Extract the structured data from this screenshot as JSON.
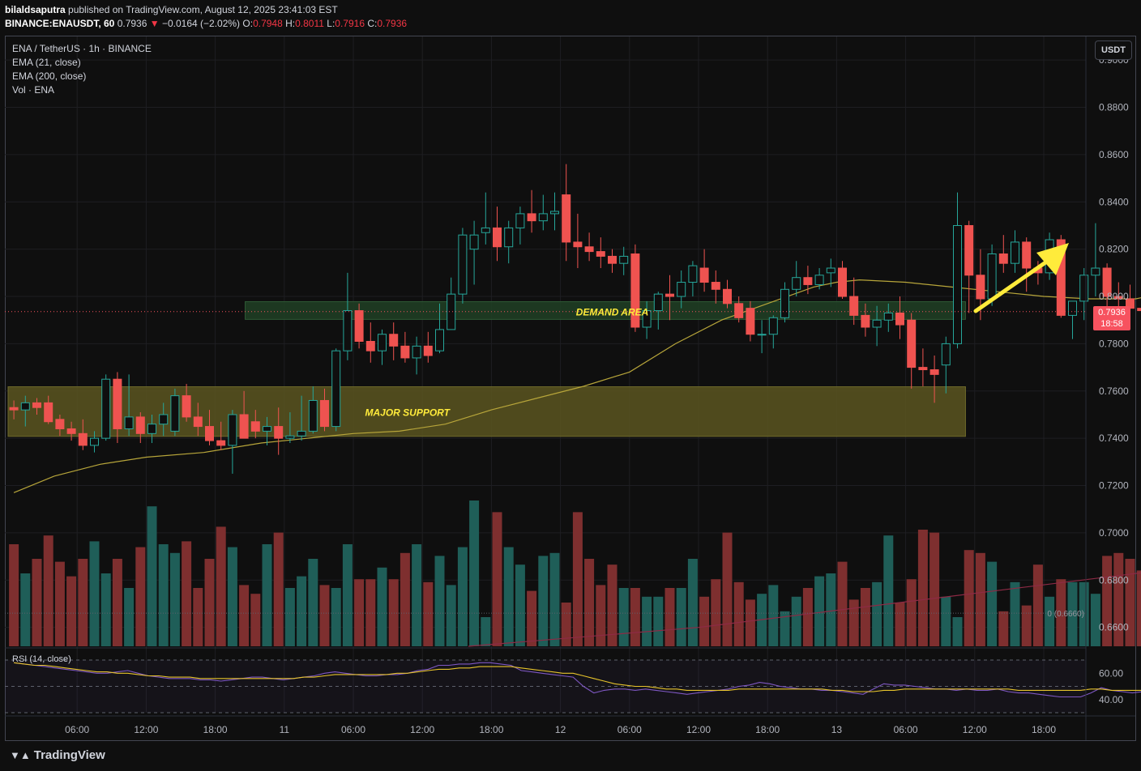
{
  "header": {
    "user": "bilaldsaputra",
    "published": "published on TradingView.com, August 12, 2025 23:41:03 EST",
    "symbol": "BINANCE:ENAUSDT, 60",
    "last": "0.7936",
    "arrow": "▼",
    "change": "−0.0164 (−2.02%)",
    "o_label": "O:",
    "o": "0.7948",
    "h_label": "H:",
    "h": "0.8011",
    "l_label": "L:",
    "l": "0.7916",
    "c_label": "C:",
    "c": "0.7936"
  },
  "legend": {
    "title": "ENA / TetherUS · 1h · BINANCE",
    "ema21": "EMA (21, close)",
    "ema200": "EMA (200, close)",
    "vol": "Vol · ENA",
    "rsi": "RSI (14, close)"
  },
  "price_scale_currency": "USDT",
  "price_badge": {
    "price": "0.7936",
    "countdown": "18:58"
  },
  "volume_zero_label": "0 (0.6660)",
  "annotations": {
    "demand": "DEMAND AREA",
    "support": "MAJOR SUPPORT"
  },
  "footer": {
    "logo_text": "TradingView",
    "logo_icon": "tradingview-logo-icon"
  },
  "colors": {
    "up": "#26a69a",
    "down": "#ef5350",
    "ema21": "#b7a53a",
    "ema200": "#8e2a45",
    "rsi": "#7e57c2",
    "rsi_ma": "#e6c32b",
    "arrow": "#ffeb3b",
    "support_zone": "#5a5520",
    "demand_zone": "#1f3d24"
  },
  "chart_data": {
    "type": "candlestick",
    "timeframe": "1h",
    "ylim": [
      0.652,
      0.91
    ],
    "y_ticks": [
      "0.9000",
      "0.8800",
      "0.8600",
      "0.8400",
      "0.8200",
      "0.8000",
      "0.7800",
      "0.7600",
      "0.7400",
      "0.7200",
      "0.7000",
      "0.6800",
      "0.6600"
    ],
    "x_ticks": [
      {
        "label": "06:00",
        "hour": 6
      },
      {
        "label": "12:00",
        "hour": 12
      },
      {
        "label": "18:00",
        "hour": 18
      },
      {
        "label": "11",
        "hour": 24
      },
      {
        "label": "06:00",
        "hour": 30
      },
      {
        "label": "12:00",
        "hour": 36
      },
      {
        "label": "18:00",
        "hour": 42
      },
      {
        "label": "12",
        "hour": 48
      },
      {
        "label": "06:00",
        "hour": 54
      },
      {
        "label": "12:00",
        "hour": 60
      },
      {
        "label": "18:00",
        "hour": 66
      },
      {
        "label": "13",
        "hour": 72
      },
      {
        "label": "06:00",
        "hour": 78
      },
      {
        "label": "12:00",
        "hour": 84
      },
      {
        "label": "18:00",
        "hour": 90
      }
    ],
    "first_candle_hour": 0.5,
    "candles": [
      [
        0.753,
        0.756,
        0.748,
        0.752
      ],
      [
        0.752,
        0.758,
        0.745,
        0.755
      ],
      [
        0.755,
        0.757,
        0.75,
        0.753
      ],
      [
        0.755,
        0.758,
        0.746,
        0.747
      ],
      [
        0.748,
        0.75,
        0.741,
        0.744
      ],
      [
        0.744,
        0.747,
        0.739,
        0.742
      ],
      [
        0.742,
        0.748,
        0.735,
        0.737
      ],
      [
        0.737,
        0.743,
        0.734,
        0.74
      ],
      [
        0.74,
        0.767,
        0.739,
        0.765
      ],
      [
        0.765,
        0.768,
        0.738,
        0.744
      ],
      [
        0.744,
        0.767,
        0.741,
        0.749
      ],
      [
        0.749,
        0.751,
        0.738,
        0.742
      ],
      [
        0.742,
        0.75,
        0.738,
        0.746
      ],
      [
        0.746,
        0.755,
        0.741,
        0.75
      ],
      [
        0.743,
        0.761,
        0.741,
        0.758
      ],
      [
        0.758,
        0.763,
        0.747,
        0.749
      ],
      [
        0.749,
        0.755,
        0.741,
        0.745
      ],
      [
        0.745,
        0.752,
        0.737,
        0.739
      ],
      [
        0.739,
        0.747,
        0.735,
        0.737
      ],
      [
        0.737,
        0.752,
        0.725,
        0.75
      ],
      [
        0.75,
        0.76,
        0.741,
        0.74
      ],
      [
        0.747,
        0.752,
        0.74,
        0.743
      ],
      [
        0.743,
        0.749,
        0.737,
        0.745
      ],
      [
        0.745,
        0.753,
        0.733,
        0.74
      ],
      [
        0.74,
        0.751,
        0.738,
        0.741
      ],
      [
        0.741,
        0.758,
        0.739,
        0.743
      ],
      [
        0.743,
        0.762,
        0.742,
        0.756
      ],
      [
        0.756,
        0.761,
        0.743,
        0.745
      ],
      [
        0.745,
        0.778,
        0.743,
        0.777
      ],
      [
        0.777,
        0.81,
        0.773,
        0.794
      ],
      [
        0.794,
        0.797,
        0.778,
        0.781
      ],
      [
        0.781,
        0.789,
        0.772,
        0.777
      ],
      [
        0.777,
        0.786,
        0.771,
        0.784
      ],
      [
        0.784,
        0.789,
        0.773,
        0.779
      ],
      [
        0.779,
        0.785,
        0.772,
        0.774
      ],
      [
        0.774,
        0.783,
        0.767,
        0.779
      ],
      [
        0.779,
        0.785,
        0.772,
        0.775
      ],
      [
        0.777,
        0.797,
        0.776,
        0.786
      ],
      [
        0.786,
        0.808,
        0.788,
        0.801
      ],
      [
        0.801,
        0.829,
        0.797,
        0.826
      ],
      [
        0.82,
        0.832,
        0.805,
        0.826
      ],
      [
        0.827,
        0.844,
        0.822,
        0.829
      ],
      [
        0.829,
        0.838,
        0.815,
        0.821
      ],
      [
        0.821,
        0.832,
        0.814,
        0.829
      ],
      [
        0.829,
        0.838,
        0.822,
        0.835
      ],
      [
        0.835,
        0.845,
        0.827,
        0.832
      ],
      [
        0.832,
        0.843,
        0.828,
        0.835
      ],
      [
        0.835,
        0.844,
        0.828,
        0.836
      ],
      [
        0.843,
        0.856,
        0.815,
        0.823
      ],
      [
        0.823,
        0.835,
        0.812,
        0.821
      ],
      [
        0.821,
        0.827,
        0.815,
        0.819
      ],
      [
        0.819,
        0.825,
        0.812,
        0.817
      ],
      [
        0.817,
        0.82,
        0.81,
        0.814
      ],
      [
        0.814,
        0.821,
        0.809,
        0.817
      ],
      [
        0.818,
        0.822,
        0.785,
        0.787
      ],
      [
        0.787,
        0.798,
        0.782,
        0.794
      ],
      [
        0.794,
        0.802,
        0.786,
        0.801
      ],
      [
        0.801,
        0.809,
        0.79,
        0.8
      ],
      [
        0.8,
        0.811,
        0.795,
        0.806
      ],
      [
        0.806,
        0.815,
        0.8,
        0.813
      ],
      [
        0.812,
        0.82,
        0.802,
        0.806
      ],
      [
        0.806,
        0.811,
        0.797,
        0.803
      ],
      [
        0.803,
        0.807,
        0.795,
        0.797
      ],
      [
        0.797,
        0.8,
        0.789,
        0.791
      ],
      [
        0.795,
        0.798,
        0.781,
        0.784
      ],
      [
        0.784,
        0.79,
        0.776,
        0.784
      ],
      [
        0.784,
        0.792,
        0.778,
        0.791
      ],
      [
        0.791,
        0.806,
        0.789,
        0.803
      ],
      [
        0.803,
        0.815,
        0.8,
        0.808
      ],
      [
        0.808,
        0.813,
        0.801,
        0.805
      ],
      [
        0.805,
        0.812,
        0.803,
        0.809
      ],
      [
        0.81,
        0.816,
        0.804,
        0.812
      ],
      [
        0.812,
        0.815,
        0.799,
        0.8
      ],
      [
        0.8,
        0.808,
        0.788,
        0.792
      ],
      [
        0.792,
        0.797,
        0.783,
        0.787
      ],
      [
        0.787,
        0.796,
        0.779,
        0.79
      ],
      [
        0.79,
        0.797,
        0.785,
        0.793
      ],
      [
        0.793,
        0.8,
        0.782,
        0.788
      ],
      [
        0.79,
        0.793,
        0.761,
        0.77
      ],
      [
        0.77,
        0.778,
        0.762,
        0.769
      ],
      [
        0.769,
        0.775,
        0.755,
        0.767
      ],
      [
        0.771,
        0.783,
        0.759,
        0.78
      ],
      [
        0.78,
        0.844,
        0.778,
        0.83
      ],
      [
        0.83,
        0.832,
        0.793,
        0.809
      ],
      [
        0.809,
        0.82,
        0.79,
        0.799
      ],
      [
        0.799,
        0.822,
        0.796,
        0.818
      ],
      [
        0.818,
        0.826,
        0.81,
        0.814
      ],
      [
        0.814,
        0.828,
        0.81,
        0.823
      ],
      [
        0.823,
        0.825,
        0.802,
        0.812
      ],
      [
        0.812,
        0.815,
        0.805,
        0.81
      ],
      [
        0.81,
        0.827,
        0.807,
        0.824
      ],
      [
        0.824,
        0.826,
        0.791,
        0.792
      ],
      [
        0.792,
        0.798,
        0.782,
        0.798
      ],
      [
        0.798,
        0.812,
        0.79,
        0.809
      ],
      [
        0.809,
        0.831,
        0.8,
        0.812
      ],
      [
        0.812,
        0.814,
        0.792,
        0.8
      ],
      [
        0.8,
        0.806,
        0.794,
        0.799
      ],
      [
        0.799,
        0.805,
        0.791,
        0.795
      ],
      [
        0.795,
        0.8,
        0.791,
        0.794
      ]
    ],
    "volumes": [
      35,
      25,
      30,
      38,
      29,
      24,
      30,
      36,
      25,
      30,
      20,
      34,
      48,
      35,
      32,
      36,
      20,
      30,
      41,
      34,
      21,
      18,
      35,
      39,
      20,
      24,
      30,
      21,
      20,
      35,
      23,
      23,
      27,
      23,
      32,
      35,
      22,
      31,
      21,
      34,
      50,
      10,
      46,
      34,
      28,
      19,
      31,
      32,
      15,
      46,
      30,
      21,
      28,
      20,
      20,
      17,
      17,
      20,
      20,
      30,
      17,
      23,
      39,
      22,
      16,
      18,
      21,
      12,
      17,
      20,
      24,
      25,
      29,
      16,
      20,
      22,
      38,
      15,
      23,
      40,
      39,
      17,
      10,
      33,
      32,
      29,
      12,
      22,
      14,
      28,
      17,
      23,
      22,
      22,
      18,
      31,
      32,
      30,
      26,
      34,
      29,
      22,
      26,
      33
    ],
    "volume_marker": 0.666,
    "ema21": [
      [
        0.5,
        0.717
      ],
      [
        4,
        0.724
      ],
      [
        8,
        0.729
      ],
      [
        12,
        0.732
      ],
      [
        17,
        0.734
      ],
      [
        22,
        0.738
      ],
      [
        26,
        0.74
      ],
      [
        30,
        0.742
      ],
      [
        34,
        0.743
      ],
      [
        38,
        0.746
      ],
      [
        42,
        0.752
      ],
      [
        46,
        0.757
      ],
      [
        50,
        0.762
      ],
      [
        54,
        0.768
      ],
      [
        58,
        0.78
      ],
      [
        62,
        0.79
      ],
      [
        66,
        0.797
      ],
      [
        70,
        0.804
      ],
      [
        72,
        0.806
      ],
      [
        74,
        0.807
      ],
      [
        78,
        0.806
      ],
      [
        82,
        0.804
      ],
      [
        86,
        0.802
      ],
      [
        90,
        0.8
      ],
      [
        94,
        0.799
      ],
      [
        98,
        0.799
      ],
      [
        102,
        0.803
      ],
      [
        106,
        0.806
      ],
      [
        110,
        0.805
      ],
      [
        114,
        0.803
      ],
      [
        118,
        0.804
      ],
      [
        122,
        0.808
      ],
      [
        126,
        0.807
      ],
      [
        130,
        0.805
      ],
      [
        134,
        0.804
      ],
      [
        138,
        0.803
      ],
      [
        140,
        0.802
      ]
    ],
    "ema200": [
      [
        40,
        0.652
      ],
      [
        60,
        0.66
      ],
      [
        80,
        0.672
      ],
      [
        100,
        0.684
      ],
      [
        120,
        0.694
      ],
      [
        140,
        0.712
      ],
      [
        160,
        0.727
      ]
    ],
    "rsi": {
      "ylim": [
        30,
        70
      ],
      "ticks": [
        "60.00",
        "40.00"
      ],
      "bands": [
        70,
        50,
        30
      ],
      "values": [
        68,
        67,
        66,
        65,
        64,
        63,
        62,
        61,
        60,
        60,
        61,
        62,
        60,
        58,
        57,
        56,
        56,
        56,
        55,
        55,
        54,
        55,
        56,
        57,
        57,
        56,
        55,
        56,
        57,
        58,
        60,
        61,
        60,
        59,
        58,
        58,
        59,
        59,
        60,
        62,
        63,
        66,
        66,
        67,
        67,
        68,
        68,
        67,
        66,
        62,
        61,
        60,
        59,
        58,
        57,
        50,
        45,
        47,
        48,
        48,
        47,
        48,
        47,
        46,
        45,
        44,
        45,
        46,
        47,
        48,
        50,
        51,
        53,
        52,
        50,
        49,
        48,
        48,
        47,
        47,
        46,
        45,
        44,
        48,
        52,
        51,
        51,
        50,
        49,
        48,
        48,
        47,
        48,
        47,
        47,
        48,
        46,
        45,
        45,
        44,
        43,
        42,
        42,
        42,
        45,
        49,
        47,
        46,
        45,
        46
      ],
      "ma": [
        68,
        67,
        66,
        66,
        65,
        64,
        63,
        62,
        61,
        61,
        60,
        60,
        59,
        58,
        58,
        57,
        57,
        57,
        56,
        56,
        56,
        56,
        56,
        56,
        56,
        56,
        56,
        56,
        57,
        57,
        58,
        59,
        59,
        59,
        59,
        59,
        59,
        60,
        60,
        61,
        62,
        63,
        63,
        64,
        64,
        65,
        65,
        65,
        65,
        64,
        63,
        62,
        61,
        60,
        60,
        58,
        56,
        54,
        52,
        51,
        50,
        50,
        49,
        48,
        48,
        47,
        47,
        47,
        47,
        47,
        48,
        48,
        48,
        48,
        48,
        48,
        48,
        48,
        48,
        47,
        47,
        46,
        46,
        46,
        47,
        47,
        48,
        48,
        48,
        48,
        48,
        48,
        48,
        48,
        48,
        48,
        48,
        47,
        47,
        47,
        47,
        47,
        47,
        47,
        48,
        48,
        47,
        47,
        47,
        47
      ]
    }
  }
}
